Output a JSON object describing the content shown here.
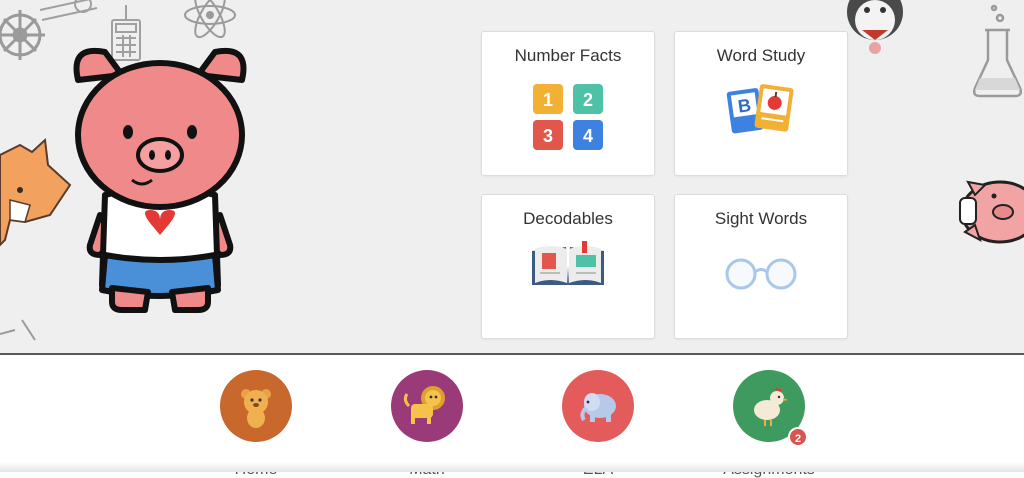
{
  "cards": {
    "number_facts": {
      "title": "Number Facts",
      "tiles": [
        "1",
        "2",
        "3",
        "4"
      ]
    },
    "word_study": {
      "title": "Word Study",
      "letter": "B"
    },
    "decodables": {
      "title": "Decodables"
    },
    "sight_words": {
      "title": "Sight Words"
    }
  },
  "nav": {
    "home": {
      "label": "Home",
      "color": "#c8682c"
    },
    "math": {
      "label": "Math",
      "color": "#9b3a78"
    },
    "ela": {
      "label": "ELA",
      "color": "#e45b5b"
    },
    "assignments": {
      "label": "Assignments",
      "color": "#3e9a5e",
      "badge": "2"
    }
  },
  "icons": [
    "pig-mascot-icon",
    "fox-icon",
    "pig-peek-icon",
    "penguin-icon",
    "flask-icon",
    "atom-icon",
    "gear-icon",
    "calculator-icon",
    "number-tiles-icon",
    "flashcards-icon",
    "open-book-icon",
    "glasses-icon",
    "bear-icon",
    "lion-icon",
    "elephant-icon",
    "chicken-icon"
  ]
}
